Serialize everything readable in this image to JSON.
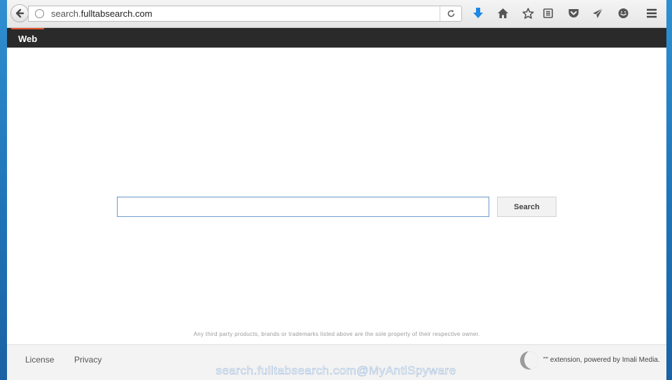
{
  "browser": {
    "url_prefix": "search.",
    "url_host": "fulltabsearch.com"
  },
  "icons": {
    "back": "arrow-left-icon",
    "site": "globe-icon",
    "reload": "reload-icon",
    "download": "download-arrow-icon",
    "home": "home-icon",
    "bookmark": "star-icon",
    "reading_list": "reading-list-icon",
    "pocket": "pocket-icon",
    "send": "send-icon",
    "chat": "chat-icon",
    "menu": "hamburger-icon"
  },
  "nav": {
    "web_label": "Web"
  },
  "search": {
    "input_value": "",
    "button_label": "Search"
  },
  "disclaimer": "Any third party products, brands or trademarks listed above are the sole property of their respective owner.",
  "footer": {
    "license": "License",
    "privacy": "Privacy",
    "powered_by": "\"\" extension, powered by Imali Media."
  },
  "watermark": "search.fulltabsearch.com@MyAntiSpyware",
  "colors": {
    "accent": "#e5522f",
    "navbar": "#2a2a2a",
    "download_icon": "#1e88e5",
    "input_border": "#6f9fd0"
  }
}
